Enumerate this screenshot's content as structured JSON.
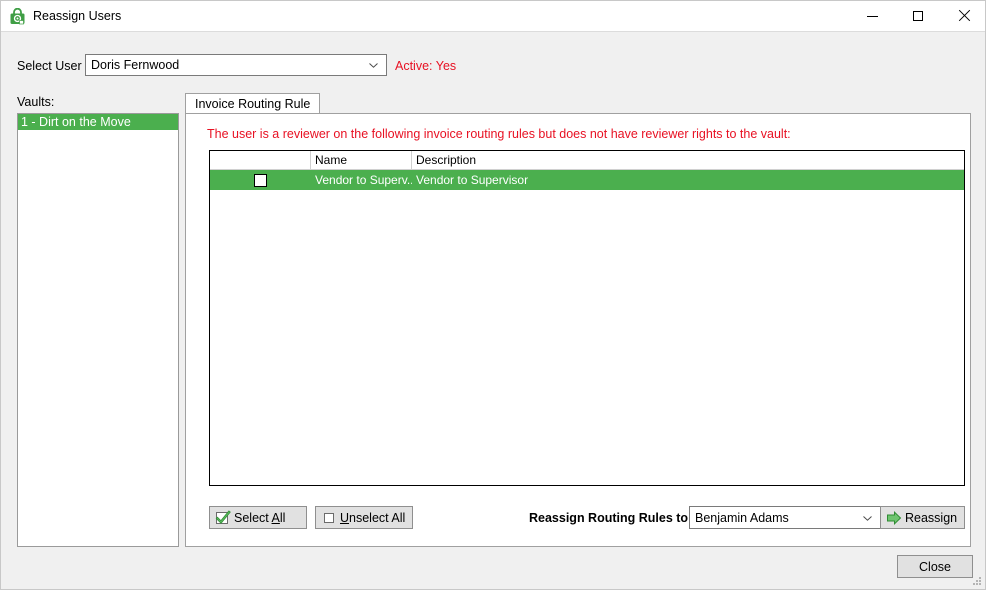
{
  "window": {
    "title": "Reassign Users",
    "icon": "vault-lock-icon",
    "controls": {
      "minimize": "minimize-icon",
      "maximize": "maximize-icon",
      "close": "close-icon"
    }
  },
  "user_row": {
    "label": "Select User",
    "selected_user": "Doris Fernwood",
    "active_status": "Active: Yes",
    "active_color": "#e81123"
  },
  "vaults": {
    "label": "Vaults:",
    "items": [
      {
        "text": "1 - Dirt on the Move",
        "selected": true
      }
    ],
    "selected_color": "#4BAF4E"
  },
  "tabs": [
    {
      "label": "Invoice Routing Rule",
      "active": true
    }
  ],
  "panel": {
    "warning": "The user is a reviewer on the following invoice routing rules but does not have reviewer rights to the vault:",
    "warning_color": "#e81123"
  },
  "grid": {
    "columns": [
      "",
      "Name",
      "Description"
    ],
    "rows": [
      {
        "checked": false,
        "name": "Vendor to Superv...",
        "description": "Vendor to Supervisor",
        "selected": true
      }
    ],
    "row_selected_color": "#4BAF4E"
  },
  "actions": {
    "select_all": {
      "label_before": "Select ",
      "label_accel": "A",
      "label_after": "ll",
      "icon": "green-check-icon"
    },
    "unselect_all": {
      "label_before": "",
      "label_accel": "U",
      "label_after": "nselect All",
      "icon": "empty-checkbox-icon"
    },
    "reassign_to_label": "Reassign Routing Rules to",
    "reassign_target": "Benjamin Adams",
    "reassign_button": {
      "label": "Reassign",
      "icon": "green-arrow-right-icon"
    }
  },
  "footer": {
    "close_label": "Close"
  }
}
